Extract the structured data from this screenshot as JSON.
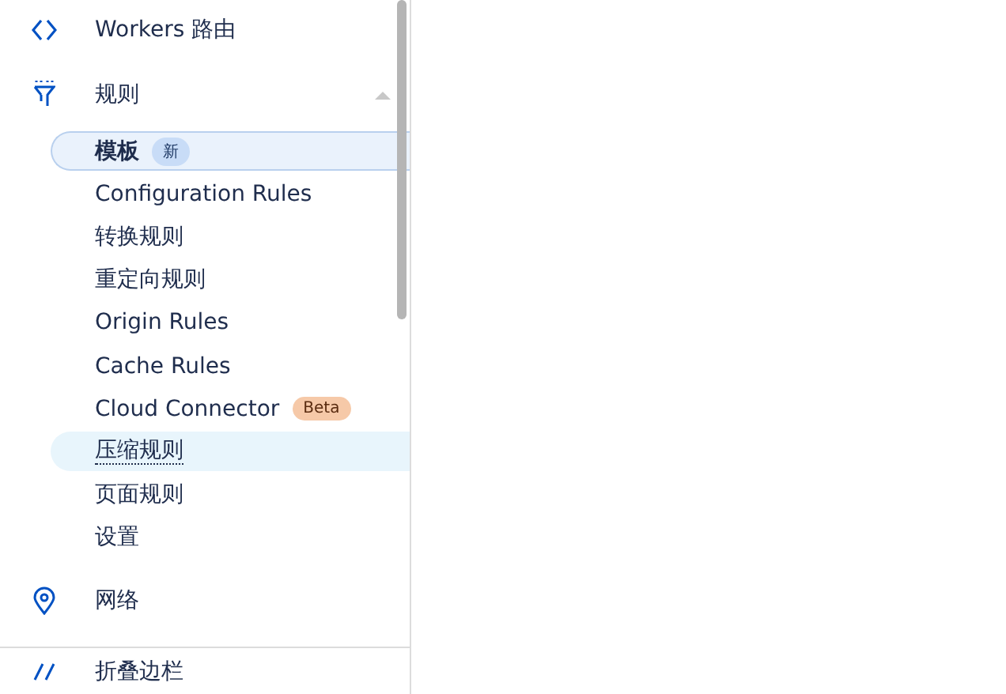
{
  "sidebar": {
    "items": [
      {
        "kind": "link",
        "label": "Workers 路由"
      },
      {
        "kind": "group",
        "label": "规则",
        "expanded": true,
        "children": [
          {
            "label": "模板",
            "selected": true,
            "hovered": false,
            "badge": {
              "text": "新",
              "kind": "new"
            }
          },
          {
            "label": "Configuration Rules",
            "selected": false,
            "hovered": false
          },
          {
            "label": "转换规则",
            "selected": false,
            "hovered": false
          },
          {
            "label": "重定向规则",
            "selected": false,
            "hovered": false
          },
          {
            "label": "Origin Rules",
            "selected": false,
            "hovered": false
          },
          {
            "label": "Cache Rules",
            "selected": false,
            "hovered": false
          },
          {
            "label": "Cloud Connector",
            "selected": false,
            "hovered": false,
            "badge": {
              "text": "Beta",
              "kind": "beta"
            }
          },
          {
            "label": "压缩规则",
            "selected": false,
            "hovered": true
          },
          {
            "label": "页面规则",
            "selected": false,
            "hovered": false
          },
          {
            "label": "设置",
            "selected": false,
            "hovered": false
          }
        ]
      },
      {
        "kind": "link",
        "label": "网络"
      }
    ],
    "collapse": {
      "label": "折叠边栏"
    }
  }
}
